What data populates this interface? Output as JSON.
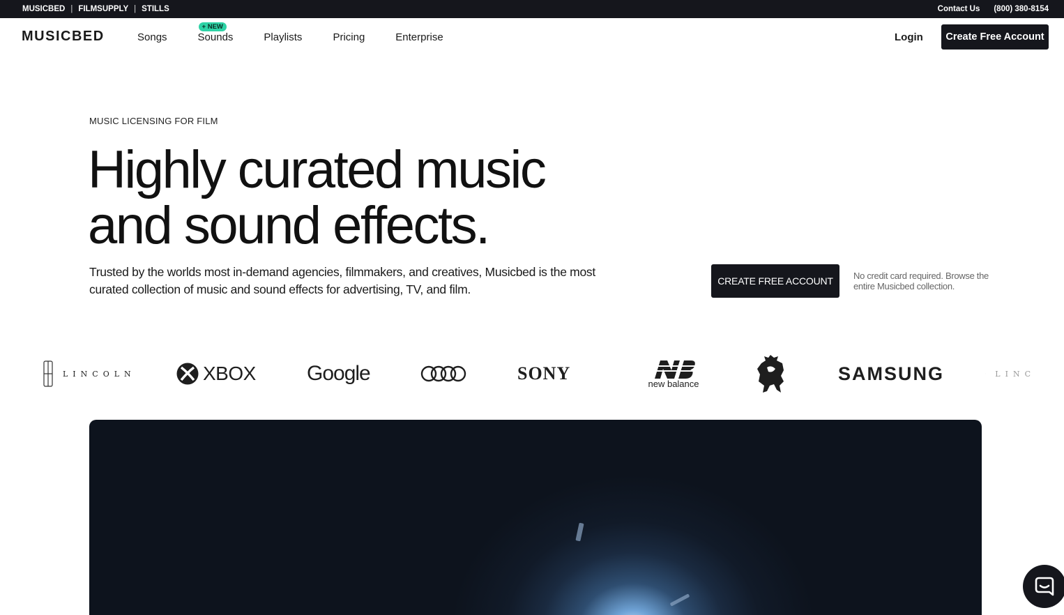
{
  "topbar": {
    "brands": [
      "MUSICBED",
      "FILMSUPPLY",
      "STILLS"
    ],
    "contact": "Contact Us",
    "phone": "(800) 380-8154"
  },
  "nav": {
    "logo": "MUSICBED",
    "links": [
      {
        "label": "Songs"
      },
      {
        "label": "Sounds",
        "badge": "+ NEW"
      },
      {
        "label": "Playlists"
      },
      {
        "label": "Pricing"
      },
      {
        "label": "Enterprise"
      }
    ],
    "login": "Login",
    "cta": "Create Free Account"
  },
  "hero": {
    "eyebrow": "MUSIC LICENSING FOR FILM",
    "headline_line1": "Highly curated music",
    "headline_line2": "and sound effects.",
    "subtext": "Trusted by the worlds most in-demand agencies, filmmakers, and creatives, Musicbed is the most curated collection of music and sound effects for advertising, TV, and film.",
    "cta": "CREATE FREE ACCOUNT",
    "note": "No credit card required. Browse the entire Musicbed collection."
  },
  "logos": {
    "lincoln": "LINCOLN",
    "xbox": "XBOX",
    "google": "Google",
    "sony": "SONY",
    "new_balance": "new balance",
    "samsung": "SAMSUNG",
    "lincoln_repeat": "LINC"
  },
  "colors": {
    "dark": "#15161c",
    "badge": "#2ed3a6"
  }
}
